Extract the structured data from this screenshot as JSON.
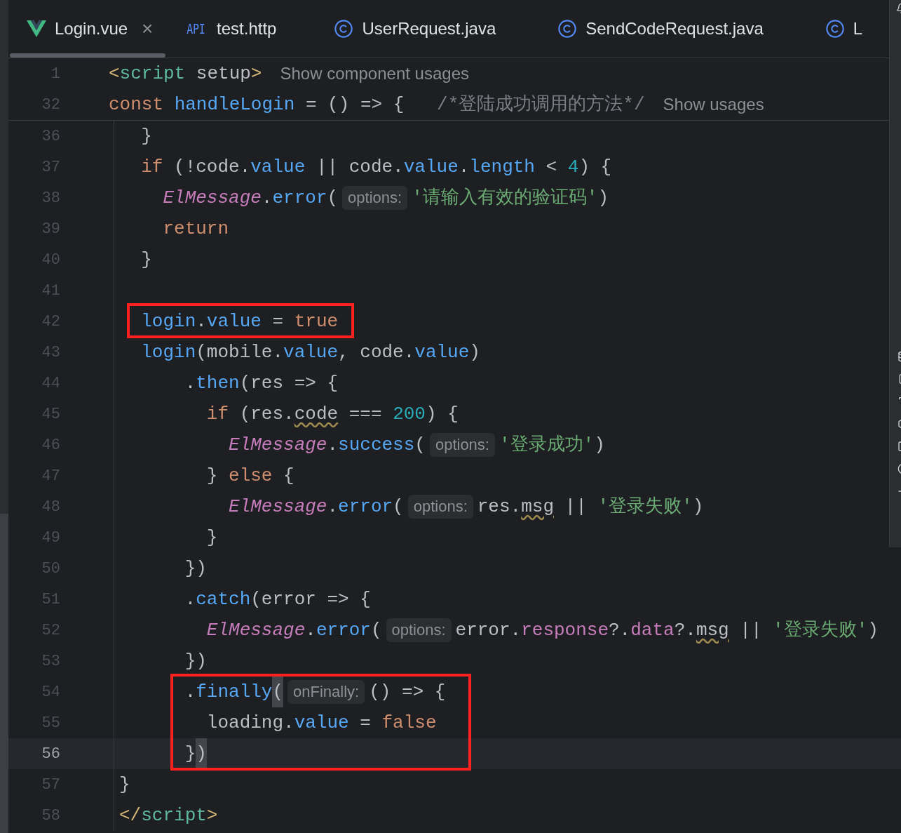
{
  "tabs": [
    {
      "kind": "vue",
      "label": "Login.vue",
      "selected": true,
      "closable": true,
      "close": "×"
    },
    {
      "kind": "api",
      "icon_label": "API",
      "label": "test.http",
      "selected": false,
      "closable": false
    },
    {
      "kind": "class",
      "label": "UserRequest.java",
      "selected": false,
      "closable": false
    },
    {
      "kind": "class",
      "label": "SendCodeRequest.java",
      "selected": false,
      "closable": false
    },
    {
      "kind": "class",
      "label": "L",
      "selected": false,
      "closable": false
    }
  ],
  "sticky_lines": [
    {
      "number": "1",
      "tokens": [
        {
          "kind": "tagb",
          "s": "<"
        },
        {
          "kind": "tag",
          "s": "script"
        },
        {
          "kind": "plain",
          "s": " setup"
        },
        {
          "kind": "tagb",
          "s": ">"
        },
        {
          "kind": "lens",
          "s": "Show component usages"
        }
      ]
    },
    {
      "number": "32",
      "tokens": [
        {
          "kind": "kw",
          "s": "const"
        },
        {
          "kind": "fn",
          "s": " handleLogin"
        },
        {
          "kind": "plain",
          "s": " = () => {   "
        },
        {
          "kind": "cmt",
          "s": "/*登陆成功调用的方法*/"
        },
        {
          "kind": "lens",
          "s": "Show usages"
        }
      ]
    }
  ],
  "lines": [
    {
      "number": "36",
      "current": false,
      "boxed": false,
      "tokens": [
        {
          "kind": "plain",
          "s": "  }"
        }
      ]
    },
    {
      "number": "37",
      "current": false,
      "boxed": false,
      "tokens": [
        {
          "kind": "kw",
          "s": "  if"
        },
        {
          "kind": "plain",
          "s": " (!code."
        },
        {
          "kind": "prop",
          "s": "value"
        },
        {
          "kind": "plain",
          "s": " || code."
        },
        {
          "kind": "prop",
          "s": "value"
        },
        {
          "kind": "plain",
          "s": "."
        },
        {
          "kind": "prop",
          "s": "length"
        },
        {
          "kind": "plain",
          "s": " < "
        },
        {
          "kind": "num",
          "s": "4"
        },
        {
          "kind": "plain",
          "s": ") {"
        }
      ]
    },
    {
      "number": "38",
      "current": false,
      "boxed": false,
      "tokens": [
        {
          "kind": "cls",
          "s": "    ElMessage"
        },
        {
          "kind": "plain",
          "s": "."
        },
        {
          "kind": "fn",
          "s": "error"
        },
        {
          "kind": "plain",
          "s": "("
        },
        {
          "kind": "hint",
          "s": "options:"
        },
        {
          "kind": "str",
          "s": "'请输入有效的验证码'"
        },
        {
          "kind": "plain",
          "s": ")"
        }
      ]
    },
    {
      "number": "39",
      "current": false,
      "boxed": false,
      "tokens": [
        {
          "kind": "kw",
          "s": "    return"
        }
      ]
    },
    {
      "number": "40",
      "current": false,
      "boxed": false,
      "tokens": [
        {
          "kind": "plain",
          "s": "  }"
        }
      ]
    },
    {
      "number": "41",
      "current": false,
      "boxed": false
    },
    {
      "number": "42",
      "current": false,
      "boxed": true,
      "tokens": [
        {
          "kind": "fn",
          "s": "  login"
        },
        {
          "kind": "plain",
          "s": "."
        },
        {
          "kind": "prop",
          "s": "value"
        },
        {
          "kind": "plain",
          "s": " = "
        },
        {
          "kind": "kw",
          "s": "true"
        }
      ]
    },
    {
      "number": "43",
      "current": false,
      "boxed": false,
      "tokens": [
        {
          "kind": "fn",
          "s": "  login"
        },
        {
          "kind": "plain",
          "s": "(mobile."
        },
        {
          "kind": "prop",
          "s": "value"
        },
        {
          "kind": "plain",
          "s": ", code."
        },
        {
          "kind": "prop",
          "s": "value"
        },
        {
          "kind": "plain",
          "s": ")"
        }
      ]
    },
    {
      "number": "44",
      "current": false,
      "boxed": false,
      "tokens": [
        {
          "kind": "plain",
          "s": "      ."
        },
        {
          "kind": "fn",
          "s": "then"
        },
        {
          "kind": "plain",
          "s": "(res => {"
        }
      ]
    },
    {
      "number": "45",
      "current": false,
      "boxed": false,
      "tokens": [
        {
          "kind": "kw",
          "s": "        if"
        },
        {
          "kind": "plain",
          "s": " (res."
        },
        {
          "kind": "warn",
          "s": "code"
        },
        {
          "kind": "plain",
          "s": " === "
        },
        {
          "kind": "num",
          "s": "200"
        },
        {
          "kind": "plain",
          "s": ") {"
        }
      ]
    },
    {
      "number": "46",
      "current": false,
      "boxed": false,
      "tokens": [
        {
          "kind": "cls",
          "s": "          ElMessage"
        },
        {
          "kind": "plain",
          "s": "."
        },
        {
          "kind": "fn",
          "s": "success"
        },
        {
          "kind": "plain",
          "s": "("
        },
        {
          "kind": "hint",
          "s": "options:"
        },
        {
          "kind": "str",
          "s": "'登录成功'"
        },
        {
          "kind": "plain",
          "s": ")"
        }
      ]
    },
    {
      "number": "47",
      "current": false,
      "boxed": false,
      "tokens": [
        {
          "kind": "plain",
          "s": "        } "
        },
        {
          "kind": "kw",
          "s": "else"
        },
        {
          "kind": "plain",
          "s": " {"
        }
      ]
    },
    {
      "number": "48",
      "current": false,
      "boxed": false,
      "tokens": [
        {
          "kind": "cls",
          "s": "          ElMessage"
        },
        {
          "kind": "plain",
          "s": "."
        },
        {
          "kind": "fn",
          "s": "error"
        },
        {
          "kind": "plain",
          "s": "("
        },
        {
          "kind": "hint",
          "s": "options:"
        },
        {
          "kind": "plain",
          "s": "res."
        },
        {
          "kind": "warn",
          "s": "msg"
        },
        {
          "kind": "plain",
          "s": " || "
        },
        {
          "kind": "str",
          "s": "'登录失败'"
        },
        {
          "kind": "plain",
          "s": ")"
        }
      ]
    },
    {
      "number": "49",
      "current": false,
      "boxed": false,
      "tokens": [
        {
          "kind": "plain",
          "s": "        }"
        }
      ]
    },
    {
      "number": "50",
      "current": false,
      "boxed": false,
      "tokens": [
        {
          "kind": "plain",
          "s": "      })"
        }
      ]
    },
    {
      "number": "51",
      "current": false,
      "boxed": false,
      "tokens": [
        {
          "kind": "plain",
          "s": "      ."
        },
        {
          "kind": "fn",
          "s": "catch"
        },
        {
          "kind": "plain",
          "s": "(error => {"
        }
      ]
    },
    {
      "number": "52",
      "current": false,
      "boxed": false,
      "tokens": [
        {
          "kind": "cls",
          "s": "        ElMessage"
        },
        {
          "kind": "plain",
          "s": "."
        },
        {
          "kind": "fn",
          "s": "error"
        },
        {
          "kind": "plain",
          "s": "("
        },
        {
          "kind": "hint",
          "s": "options:"
        },
        {
          "kind": "plain",
          "s": "error."
        },
        {
          "kind": "field",
          "s": "response"
        },
        {
          "kind": "plain",
          "s": "?."
        },
        {
          "kind": "field",
          "s": "data"
        },
        {
          "kind": "plain",
          "s": "?."
        },
        {
          "kind": "warn",
          "s": "msg"
        },
        {
          "kind": "plain",
          "s": " || "
        },
        {
          "kind": "str",
          "s": "'登录失败'"
        },
        {
          "kind": "plain",
          "s": ")"
        }
      ]
    },
    {
      "number": "53",
      "current": false,
      "boxed": false,
      "tokens": [
        {
          "kind": "plain",
          "s": "      })"
        }
      ]
    },
    {
      "number": "54",
      "current": false,
      "boxed": true,
      "tokens": [
        {
          "kind": "plain",
          "s": "      ."
        },
        {
          "kind": "fn",
          "s": "finally"
        },
        {
          "kind": "match",
          "s": "("
        },
        {
          "kind": "hint",
          "s": "onFinally:"
        },
        {
          "kind": "plain",
          "s": "() => {"
        }
      ]
    },
    {
      "number": "55",
      "current": false,
      "boxed": true,
      "tokens": [
        {
          "kind": "plain",
          "s": "        loading."
        },
        {
          "kind": "prop",
          "s": "value"
        },
        {
          "kind": "plain",
          "s": " = "
        },
        {
          "kind": "kw",
          "s": "false"
        }
      ]
    },
    {
      "number": "56",
      "current": true,
      "boxed": true,
      "tokens": [
        {
          "kind": "plain",
          "s": "      }"
        },
        {
          "kind": "match",
          "s": ")"
        }
      ]
    },
    {
      "number": "57",
      "current": false,
      "boxed": false,
      "tokens": [
        {
          "kind": "plain",
          "s": "}"
        }
      ]
    },
    {
      "number": "58",
      "current": false,
      "boxed": false,
      "tokens": [
        {
          "kind": "tagb",
          "s": "</"
        },
        {
          "kind": "tag",
          "s": "script"
        },
        {
          "kind": "tagb",
          "s": ">"
        }
      ]
    }
  ]
}
